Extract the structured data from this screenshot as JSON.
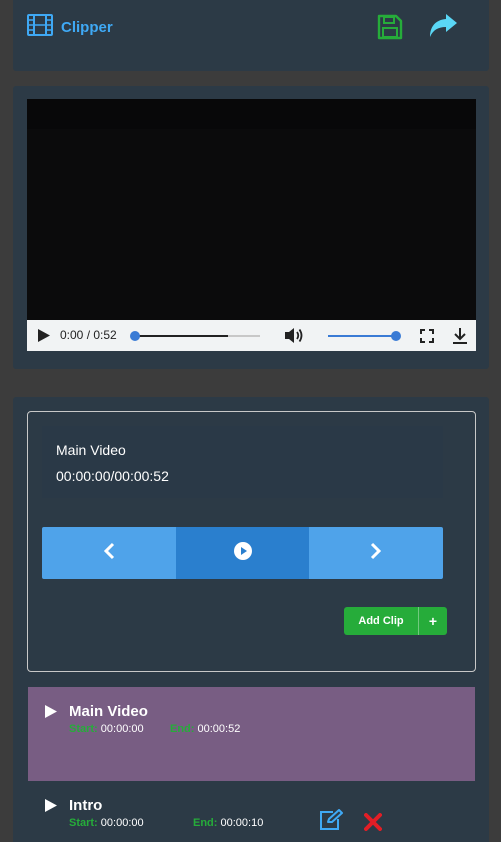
{
  "app": {
    "brand": "Clipper",
    "icons": {
      "brand": "film-icon",
      "save": "save-icon",
      "share": "share-icon"
    },
    "colors": {
      "accent": "#3fa9f5",
      "save": "#26ac3a",
      "share": "#5ad7f6",
      "active_clip": "#785d83"
    }
  },
  "player": {
    "time": "0:00 / 0:52",
    "progress": 0.0,
    "volume": 1.0,
    "icons": [
      "play-icon",
      "volume-icon",
      "fullscreen-icon",
      "download-icon"
    ]
  },
  "editor": {
    "current_title": "Main Video",
    "current_time": "00:00:00/00:00:52",
    "nav": [
      "previous-icon",
      "play-circle-icon",
      "next-icon"
    ],
    "add_clip_label": "Add Clip",
    "add_clip_icon": "+"
  },
  "clips": [
    {
      "name": "Main Video",
      "start_label": "Start:",
      "start": "00:00:00",
      "end_label": "End:",
      "end": "00:00:52",
      "active": true
    },
    {
      "name": "Intro",
      "start_label": "Start:",
      "start": "00:00:00",
      "end_label": "End:",
      "end": "00:00:10",
      "active": false,
      "actions": [
        "edit-icon",
        "delete-icon"
      ]
    }
  ]
}
